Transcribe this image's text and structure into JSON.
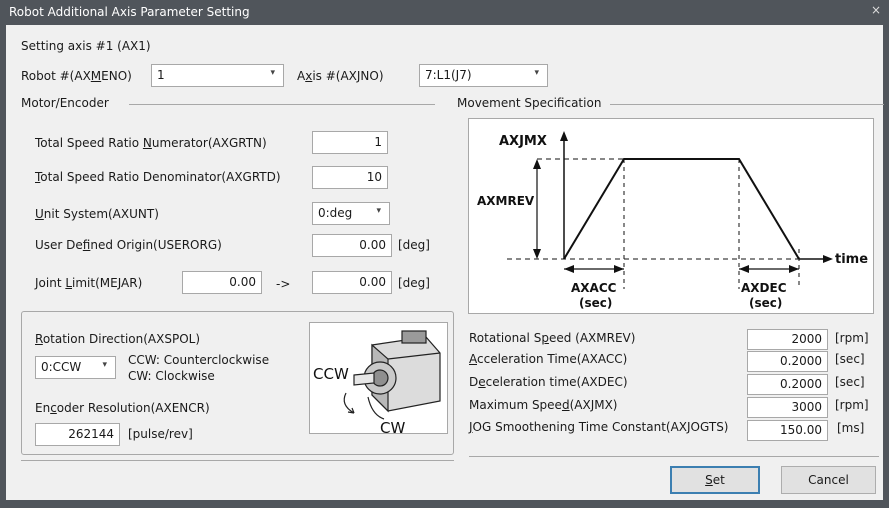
{
  "window": {
    "title": "Robot Additional Axis Parameter Setting",
    "close_glyph": "×"
  },
  "setting_axis_label": "Setting axis #1 (AX1)",
  "robot": {
    "label_pre": "Robot #(AX",
    "label_ul": "M",
    "label_post": "ENO)",
    "value": "1"
  },
  "axis": {
    "label_pre": "A",
    "label_ul": "x",
    "label_post": "is #(AXJNO)",
    "value": "7:L1(J7)"
  },
  "motor_encoder_heading": "Motor/Encoder",
  "movement_heading": "Movement Specification",
  "motor": {
    "numerator": {
      "pre": "Total Speed Ratio ",
      "ul": "N",
      "post": "umerator(AXGRTN)",
      "value": "1"
    },
    "denominator": {
      "pre": "",
      "ul": "T",
      "post": "otal Speed Ratio Denominator(AXGRTD)",
      "value": "10"
    },
    "unit_system": {
      "pre": "",
      "ul": "U",
      "post": "nit System(AXUNT)",
      "value": "0:deg"
    },
    "user_origin": {
      "pre": "User De",
      "ul": "f",
      "post": "ined Origin(USERORG)",
      "value": "0.00",
      "unit": "[deg]"
    },
    "joint_limit": {
      "pre": "Joint ",
      "ul": "L",
      "post": "imit(MEJAR)",
      "min": "0.00",
      "arrow": "->",
      "max": "0.00",
      "unit": "[deg]"
    }
  },
  "rotation": {
    "label_pre": "",
    "label_ul": "R",
    "label_post": "otation Direction(AXSPOL)",
    "value": "0:CCW",
    "ccw_desc": "CCW: Counterclockwise",
    "cw_desc": "CW: Clockwise",
    "encoder_pre": "En",
    "encoder_ul": "c",
    "encoder_post": "oder Resolution(AXENCR)",
    "encoder_value": "262144",
    "encoder_unit": "[pulse/rev]",
    "motor_ccw": "CCW",
    "motor_cw": "CW"
  },
  "diagram": {
    "axjmx": "AXJMX",
    "axmrev": "AXMREV",
    "time": "time",
    "axacc": "AXACC",
    "axacc_sec": "(sec)",
    "axdec": "AXDEC",
    "axdec_sec": "(sec)"
  },
  "movement": {
    "rot_speed": {
      "pre": "Rotational S",
      "ul": "p",
      "post": "eed (AXMREV)",
      "value": "2000",
      "unit": "[rpm]"
    },
    "accel": {
      "pre": "",
      "ul": "A",
      "post": "cceleration Time(AXACC)",
      "value": "0.2000",
      "unit": "[sec]"
    },
    "decel": {
      "pre": "D",
      "ul": "e",
      "post": "celeration time(AXDEC)",
      "value": "0.2000",
      "unit": "[sec]"
    },
    "max_speed": {
      "pre": "Maximum Spee",
      "ul": "d",
      "post": "(AXJMX)",
      "value": "3000",
      "unit": "[rpm]"
    },
    "jog": {
      "pre": "",
      "ul": "J",
      "post": "OG Smoothening Time Constant(AXJOGTS)",
      "value": "150.00",
      "unit": "[ms]"
    }
  },
  "buttons": {
    "set_ul": "S",
    "set_post": "et",
    "cancel": "Cancel"
  },
  "colors": {
    "title_bar": "#50555b",
    "dialog_bg": "#f0f0f0",
    "default_button_border": "#3c7fb1"
  }
}
